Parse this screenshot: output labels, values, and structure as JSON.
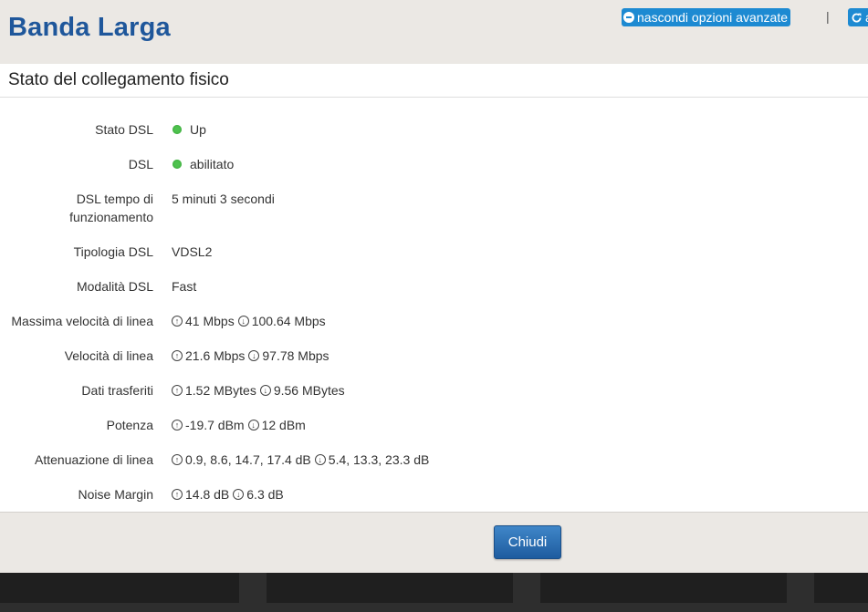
{
  "header": {
    "title": "Banda Larga",
    "advanced_label": "nascondi opzioni avanzate",
    "separator": "|",
    "refresh_label": "a"
  },
  "section": {
    "title": "Stato del collegamento fisico"
  },
  "rows": [
    {
      "label": "Stato DSL",
      "status": "green",
      "value": "Up"
    },
    {
      "label": "DSL",
      "status": "green",
      "value": "abilitato"
    },
    {
      "label": "DSL tempo di funzionamento",
      "value": "5 minuti 3 secondi"
    },
    {
      "label": "Tipologia DSL",
      "value": "VDSL2"
    },
    {
      "label": "Modalità DSL",
      "value": "Fast"
    },
    {
      "label": "Massima velocità di linea",
      "up": "41 Mbps",
      "down": "100.64 Mbps"
    },
    {
      "label": "Velocità di linea",
      "up": "21.6 Mbps",
      "down": "97.78 Mbps"
    },
    {
      "label": "Dati trasferiti",
      "up": "1.52 MBytes",
      "down": "9.56 MBytes"
    },
    {
      "label": "Potenza",
      "up": "-19.7 dBm",
      "down": "12 dBm"
    },
    {
      "label": "Attenuazione di linea",
      "up": "0.9, 8.6, 14.7, 17.4 dB",
      "down": "5.4, 13.3, 23.3 dB"
    },
    {
      "label": "Noise Margin",
      "up": "14.8 dB",
      "down": "6.3 dB"
    }
  ],
  "footer": {
    "close_label": "Chiudi"
  },
  "colors": {
    "accent": "#1d8ad2",
    "title": "#1f579b",
    "status_ok": "#4fc24f"
  },
  "icons": {
    "up": "arrow-up-circle-icon",
    "down": "arrow-down-circle-icon",
    "status": "status-dot-icon"
  }
}
